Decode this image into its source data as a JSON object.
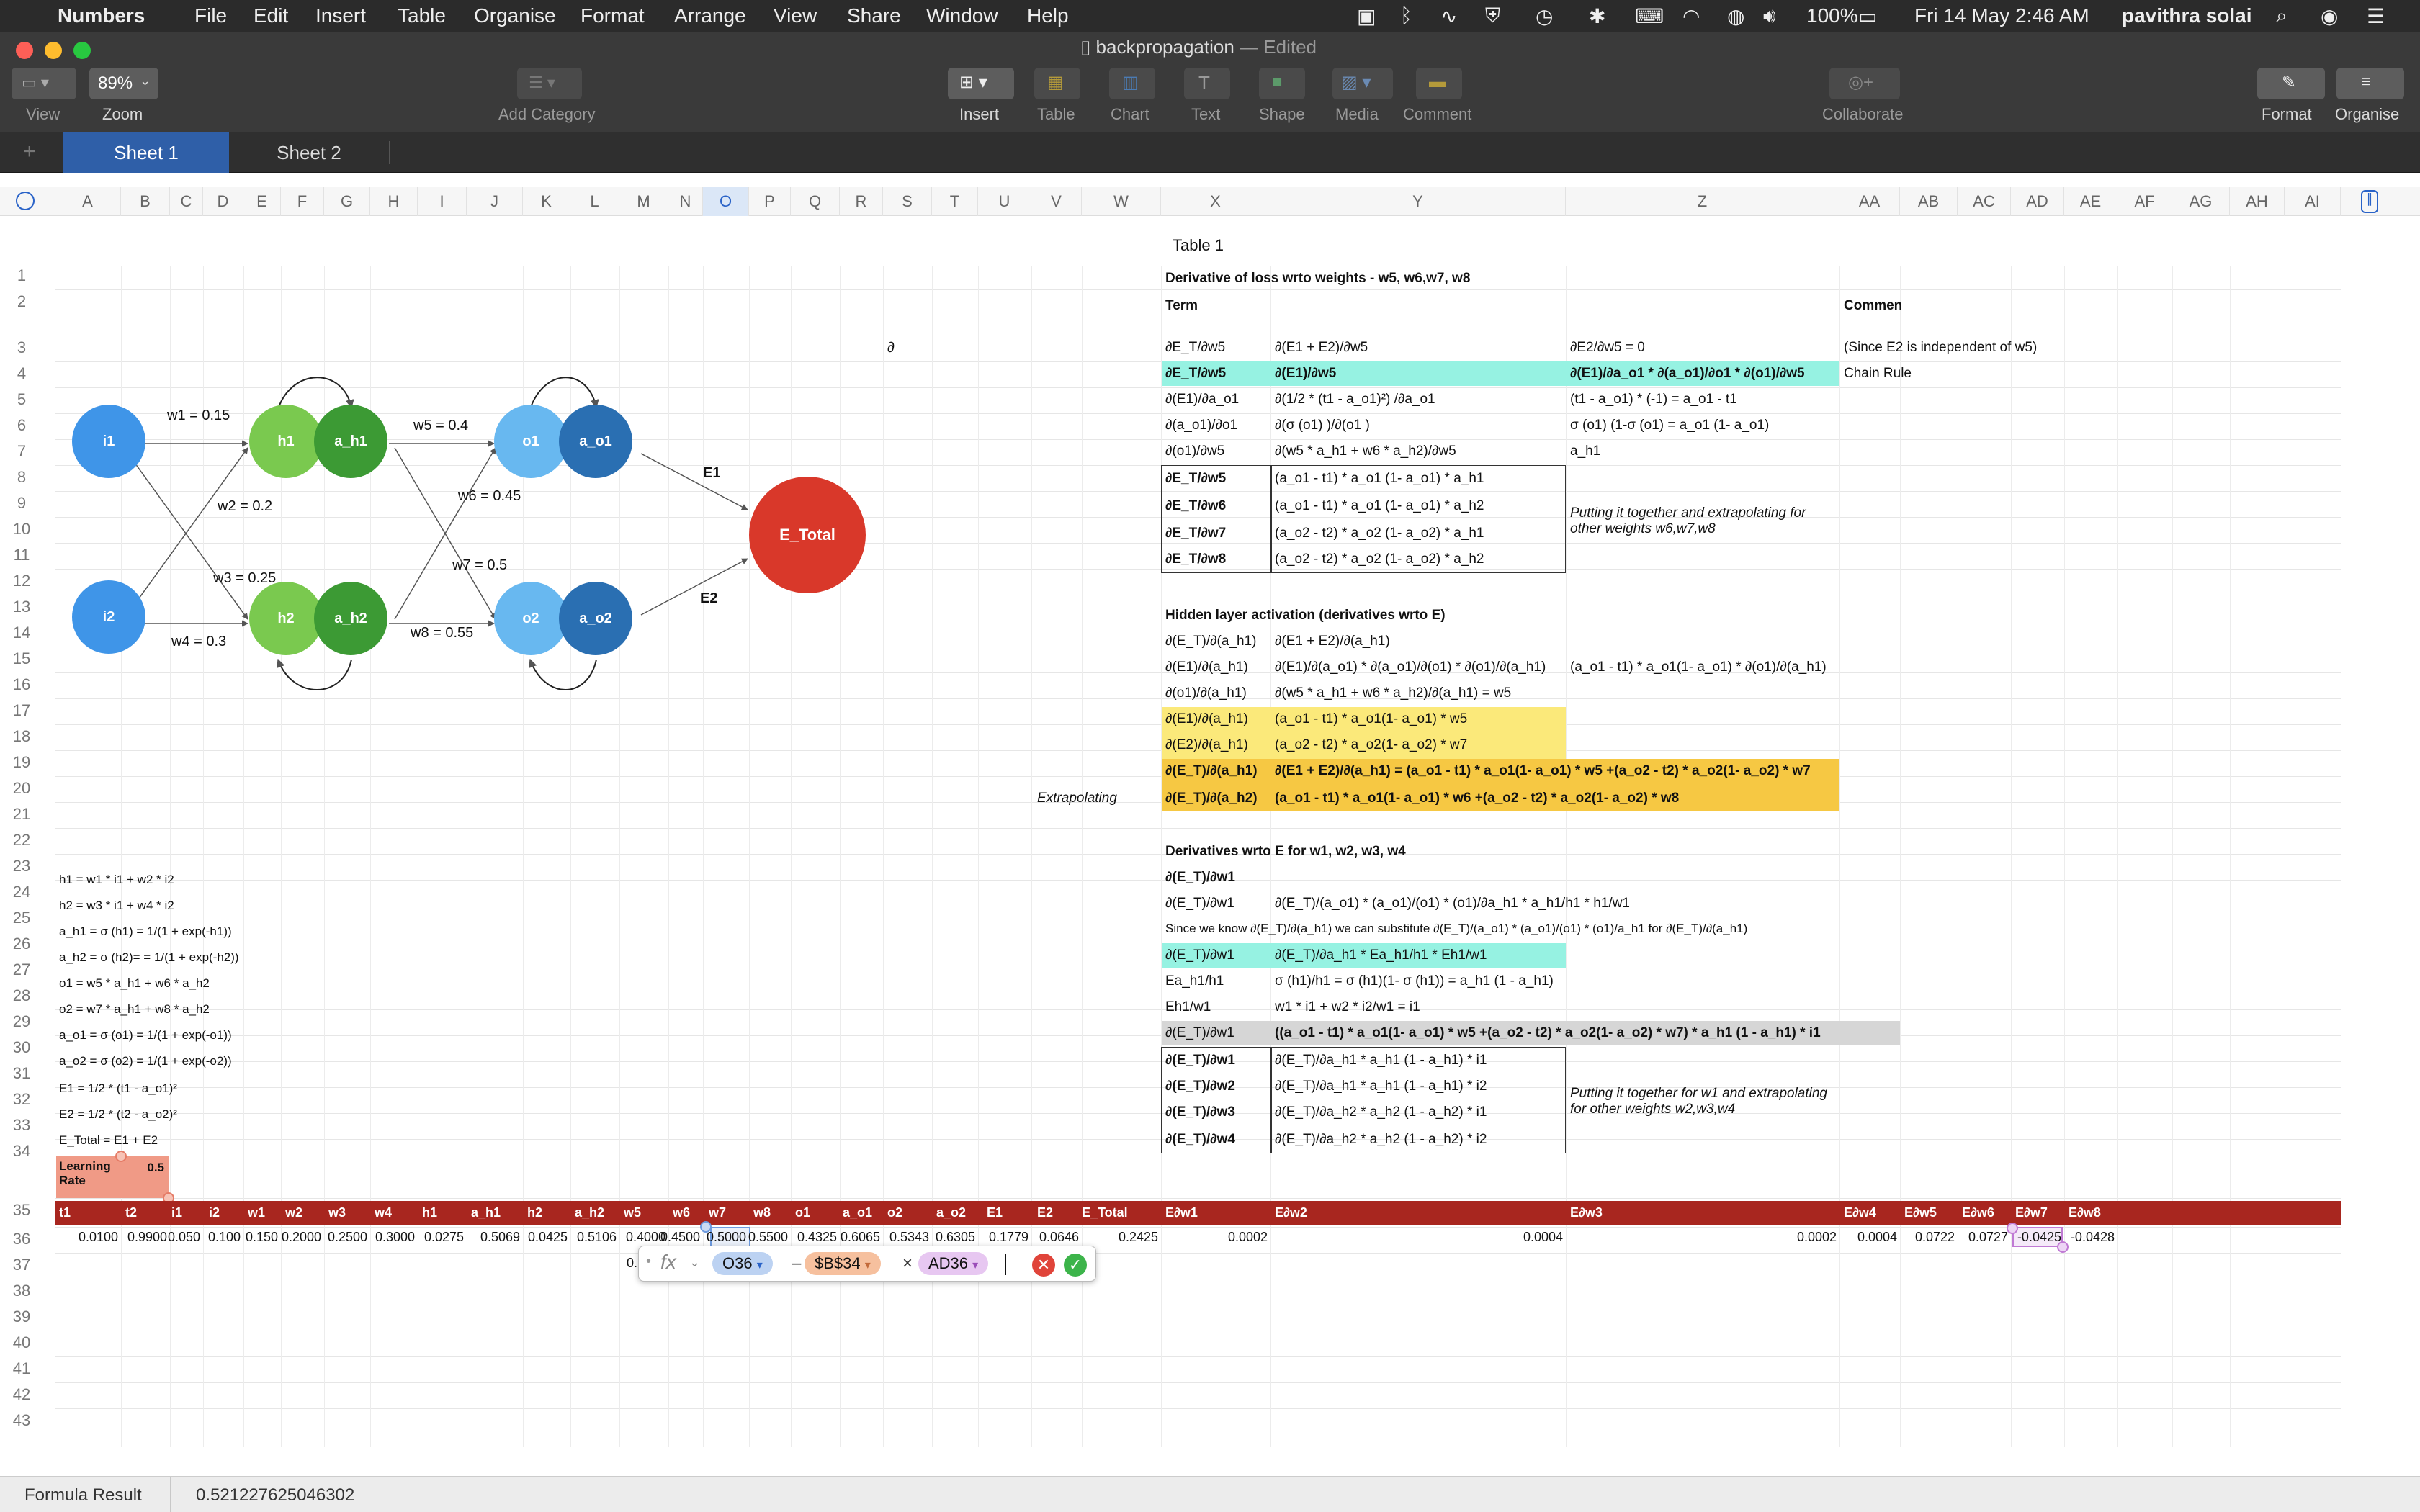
{
  "menubar": {
    "app": "Numbers",
    "items": [
      "File",
      "Edit",
      "Insert",
      "Table",
      "Organise",
      "Format",
      "Arrange",
      "View",
      "Share",
      "Window",
      "Help"
    ],
    "battery": "100%",
    "datetime": "Fri 14 May  2:46 AM",
    "user": "pavithra solai"
  },
  "window": {
    "title": "backpropagation",
    "edited": "— Edited"
  },
  "toolbar": {
    "view": "View",
    "zoom_value": "89%",
    "zoom": "Zoom",
    "add_category": "Add Category",
    "insert": "Insert",
    "table": "Table",
    "chart": "Chart",
    "text": "Text",
    "shape": "Shape",
    "media": "Media",
    "comment": "Comment",
    "collaborate": "Collaborate",
    "format": "Format",
    "organise": "Organise"
  },
  "tabs": [
    "Sheet 1",
    "Sheet 2"
  ],
  "columns": [
    "A",
    "B",
    "C",
    "D",
    "E",
    "F",
    "G",
    "H",
    "I",
    "J",
    "K",
    "L",
    "M",
    "N",
    "O",
    "P",
    "Q",
    "R",
    "S",
    "T",
    "U",
    "V",
    "W",
    "X",
    "Y",
    "Z",
    "AA",
    "AB",
    "AC",
    "AD",
    "AE",
    "AF",
    "AG",
    "AH",
    "AI"
  ],
  "table_title": "Table 1",
  "diagram": {
    "i1": "i1",
    "i2": "i2",
    "h1": "h1",
    "a_h1": "a_h1",
    "h2": "h2",
    "a_h2": "a_h2",
    "o1": "o1",
    "a_o1": "a_o1",
    "o2": "o2",
    "a_o2": "a_o2",
    "etotal": "E_Total",
    "w1": "w1 = 0.15",
    "w2": "w2 = 0.2",
    "w3": "w3 = 0.25",
    "w4": "w4 = 0.3",
    "w5": "w5 = 0.4",
    "w6": "w6 = 0.45",
    "w7": "w7 = 0.5",
    "w8": "w8 = 0.55",
    "e1": "E1",
    "e2": "E2"
  },
  "partial_symbol": "∂",
  "section1": {
    "title": "Derivative of loss wrto weights - w5, w6,w7, w8",
    "term": "Term",
    "comments": "Comments",
    "r3": [
      "∂E_T/∂w5",
      "∂(E1 + E2)/∂w5",
      "∂E2/∂w5 = 0",
      "(Since E2 is independent of w5)"
    ],
    "r4": [
      "∂E_T/∂w5",
      "∂(E1)/∂w5",
      "∂(E1)/∂a_o1 * ∂(a_o1)/∂o1 * ∂(o1)/∂w5",
      "Chain Rule"
    ],
    "r5": [
      "∂(E1)/∂a_o1",
      "∂(1/2 * (t1 - a_o1)²) /∂a_o1",
      "(t1 - a_o1) * (-1) = a_o1 - t1"
    ],
    "r6": [
      "∂(a_o1)/∂o1",
      "∂(σ (o1) )/∂(o1 )",
      "σ (o1) (1-σ (o1)  = a_o1 (1- a_o1)"
    ],
    "r7": [
      "∂(o1)/∂w5",
      "∂(w5 * a_h1  + w6 * a_h2)/∂w5",
      "a_h1"
    ],
    "box": [
      [
        "∂E_T/∂w5",
        "(a_o1 - t1) * a_o1 (1- a_o1) * a_h1"
      ],
      [
        "∂E_T/∂w6",
        "(a_o1 - t1) * a_o1 (1- a_o1) * a_h2"
      ],
      [
        "∂E_T/∂w7",
        "(a_o2 - t2) * a_o2 (1- a_o2) * a_h1"
      ],
      [
        "∂E_T/∂w8",
        "(a_o2 - t2) * a_o2 (1- a_o2) * a_h2"
      ]
    ],
    "note": "Putting it together and extrapolating for other weights w6,w7,w8"
  },
  "section2": {
    "title": "Hidden layer activation (derivatives wrto E)",
    "r14": [
      "∂(E_T)/∂(a_h1)",
      "∂(E1 + E2)/∂(a_h1)"
    ],
    "r15": [
      "∂(E1)/∂(a_h1)",
      "∂(E1)/∂(a_o1) * ∂(a_o1)/∂(o1) * ∂(o1)/∂(a_h1)",
      "(a_o1 - t1) * a_o1(1- a_o1) * ∂(o1)/∂(a_h1)"
    ],
    "r16": [
      "∂(o1)/∂(a_h1)",
      "∂(w5 * a_h1  + w6 * a_h2)/∂(a_h1) = w5"
    ],
    "r17": [
      "∂(E1)/∂(a_h1)",
      "(a_o1 - t1) * a_o1(1- a_o1) * w5"
    ],
    "r18": [
      "∂(E2)/∂(a_h1)",
      "(a_o2 - t2) * a_o2(1- a_o2) * w7"
    ],
    "r19": [
      "∂(E_T)/∂(a_h1)",
      "∂(E1 + E2)/∂(a_h1) = (a_o1 - t1) * a_o1(1- a_o1) * w5 +(a_o2 - t2) * a_o2(1- a_o2) * w7"
    ],
    "r20": [
      "Extrapolating",
      "∂(E_T)/∂(a_h2)",
      "(a_o1 - t1) * a_o1(1- a_o1) * w6 +(a_o2 - t2) * a_o2(1- a_o2) * w8"
    ]
  },
  "section3": {
    "title": "Derivatives wrto E for w1, w2, w3, w4",
    "r23": [
      "∂(E_T)/∂w1"
    ],
    "r24": [
      "∂(E_T)/∂w1",
      "∂(E_T)/(a_o1) *  (a_o1)/(o1)  * (o1)/∂a_h1 * a_h1/h1 * h1/w1"
    ],
    "r25": "Since we know ∂(E_T)/∂(a_h1) we can substitute ∂(E_T)/(a_o1) *  (a_o1)/(o1)  * (o1)/a_h1  for ∂(E_T)/∂(a_h1)",
    "r26": [
      "∂(E_T)/∂w1",
      "∂(E_T)/∂a_h1 * Ea_h1/h1 * Eh1/w1"
    ],
    "r27": [
      "Ea_h1/h1",
      "σ (h1)/h1 = σ (h1)(1- σ (h1)) = a_h1 (1 - a_h1)"
    ],
    "r28": [
      "Eh1/w1",
      "w1 * i1 + w2 * i2/w1 = i1"
    ],
    "r29": [
      "∂(E_T)/∂w1",
      "((a_o1 - t1) * a_o1(1- a_o1) * w5 +(a_o2 - t2) * a_o2(1- a_o2) * w7) * a_h1 (1 - a_h1) * i1"
    ],
    "box": [
      [
        "∂(E_T)/∂w1",
        "∂(E_T)/∂a_h1 * a_h1 (1 - a_h1) * i1"
      ],
      [
        "∂(E_T)/∂w2",
        "∂(E_T)/∂a_h1 * a_h1 (1 - a_h1) * i2"
      ],
      [
        "∂(E_T)/∂w3",
        "∂(E_T)/∂a_h2 * a_h2 (1 - a_h2) * i1"
      ],
      [
        "∂(E_T)/∂w4",
        "∂(E_T)/∂a_h2 * a_h2 (1 - a_h2) * i2"
      ]
    ],
    "note": "Putting it together for w1 and extrapolating for other weights w2,w3,w4"
  },
  "formulas": [
    "h1 = w1 * i1 + w2 * i2",
    "h2 = w3 * i1 + w4 * i2",
    "a_h1 = σ (h1) = 1/(1 + exp(-h1))",
    "a_h2 = σ (h2)= = 1/(1 + exp(-h2))",
    "o1 = w5 * a_h1  + w6 * a_h2",
    "o2 = w7 * a_h1  + w8 * a_h2",
    "a_o1 = σ (o1) = 1/(1 + exp(-o1))",
    "a_o2 = σ (o2) = 1/(1 + exp(-o2))",
    "E1 = 1/2 * (t1 - a_o1)²",
    "E2 = 1/2 * (t2 - a_o2)²",
    "E_Total = E1 + E2"
  ],
  "learning_rate": {
    "label": "Learning Rate",
    "value": "0.5"
  },
  "header_row": [
    "t1",
    "t2",
    "i1",
    "i2",
    "w1",
    "w2",
    "w3",
    "w4",
    "h1",
    "a_h1",
    "h2",
    "a_h2",
    "w5",
    "w6",
    "w7",
    "w8",
    "o1",
    "a_o1",
    "o2",
    "a_o2",
    "E1",
    "E2",
    "E_Total",
    "E∂w1",
    "E∂w2",
    "E∂w3",
    "E∂w4",
    "E∂w5",
    "E∂w6",
    "E∂w7",
    "E∂w8"
  ],
  "value_row": [
    "0.0100",
    "0.9900",
    "0.050",
    "0.100",
    "0.150",
    "0.2000",
    "0.2500",
    "0.3000",
    "0.0275",
    "0.5069",
    "0.0425",
    "0.5106",
    "0.4000",
    "0.4500",
    "0.5000",
    "0.5500",
    "0.4325",
    "0.6065",
    "0.5343",
    "0.6305",
    "0.1779",
    "0.0646",
    "0.2425",
    "0.0002",
    "0.0004",
    "0.0002",
    "0.0004",
    "0.0722",
    "0.0727",
    "-0.0425",
    "-0.0428"
  ],
  "row37_stub": "0.",
  "formula_editor": {
    "fx": "fx",
    "t1": "O36",
    "op1": "–",
    "t2": "$B$34",
    "op2": "×",
    "t3": "AD36"
  },
  "status": {
    "label": "Formula Result",
    "value": "0.521227625046302"
  }
}
